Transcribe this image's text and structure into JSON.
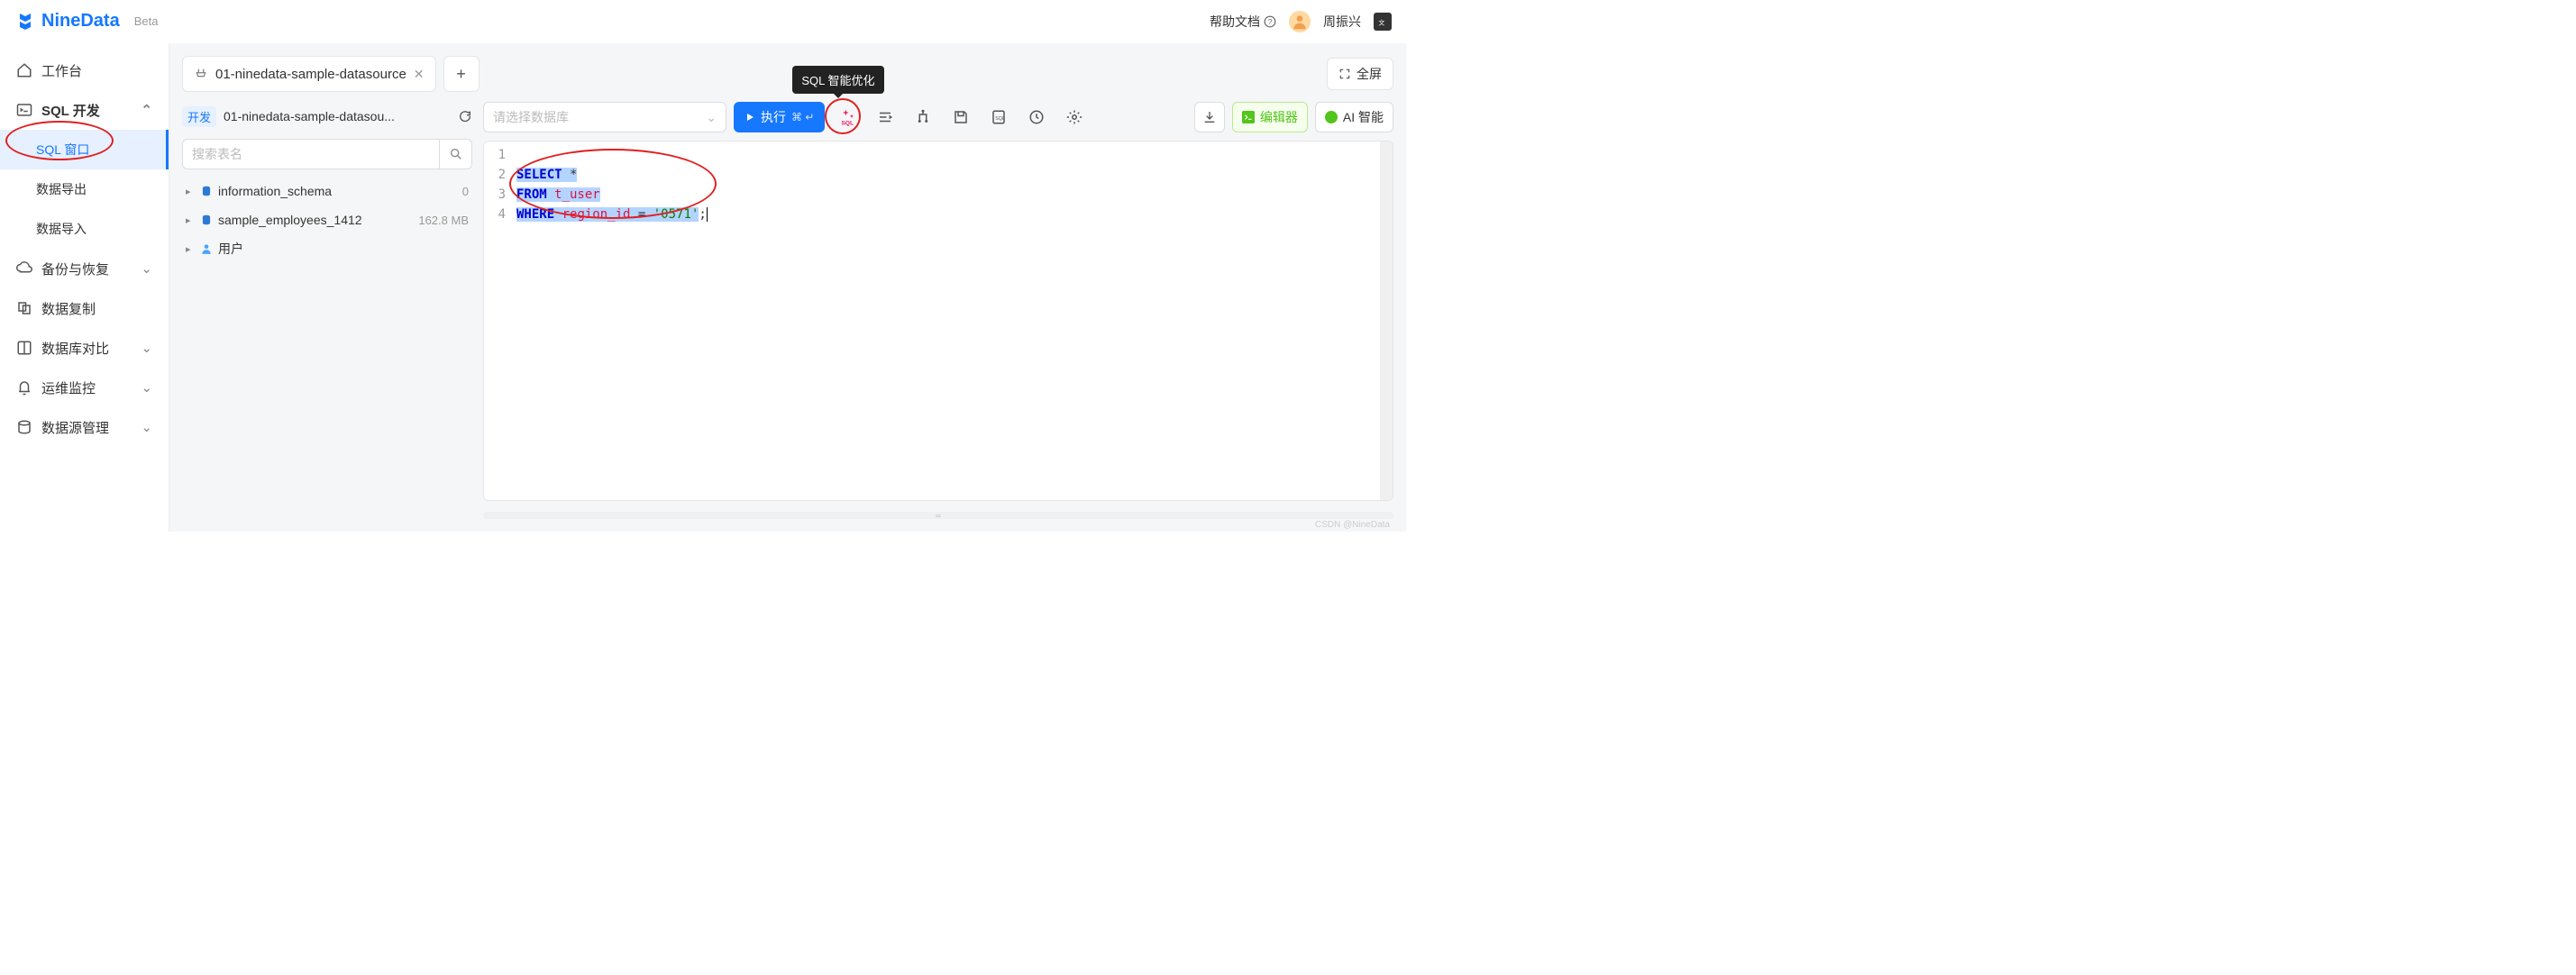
{
  "header": {
    "brand": "NineData",
    "beta": "Beta",
    "help": "帮助文档",
    "username": "周振兴"
  },
  "sidebar": {
    "workbench": "工作台",
    "sql_dev": "SQL 开发",
    "sql_window": "SQL 窗口",
    "data_export": "数据导出",
    "data_import": "数据导入",
    "backup": "备份与恢复",
    "replication": "数据复制",
    "compare": "数据库对比",
    "ops": "运维监控",
    "datasource": "数据源管理"
  },
  "tab": {
    "title": "01-ninedata-sample-datasource",
    "add": "+",
    "fullscreen": "全屏"
  },
  "left_panel": {
    "ds_badge": "开发",
    "ds_name": "01-ninedata-sample-datasou...",
    "search_placeholder": "搜索表名",
    "tree": [
      {
        "name": "information_schema",
        "meta": "0",
        "icon": "db"
      },
      {
        "name": "sample_employees_1412",
        "meta": "162.8 MB",
        "icon": "db"
      },
      {
        "name": "用户",
        "meta": "",
        "icon": "user"
      }
    ]
  },
  "toolbar": {
    "db_placeholder": "请选择数据库",
    "run": "执行",
    "run_kbd": "⌘ ↵",
    "tooltip": "SQL 智能优化",
    "editor_btn": "编辑器",
    "ai_btn": "AI 智能"
  },
  "editor": {
    "lines": [
      "1",
      "2",
      "3",
      "4"
    ],
    "sql": {
      "l2_kw": "SELECT",
      "l2_rest": " *",
      "l3_kw": "FROM",
      "l3_id": " t_user",
      "l4_kw": "WHERE",
      "l4_id": " region_id",
      "l4_op": " = ",
      "l4_str": "'0571'",
      "l4_semi": ";"
    }
  },
  "watermark": "CSDN @NineData"
}
